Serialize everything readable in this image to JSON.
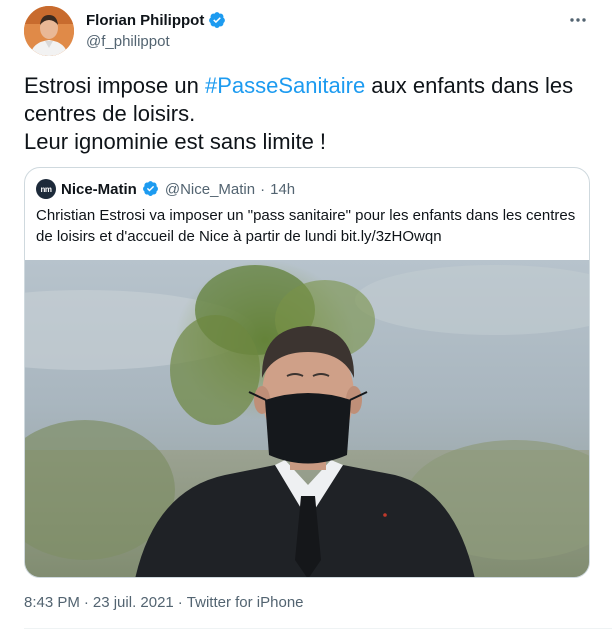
{
  "tweet": {
    "author": {
      "display_name": "Florian Philippot",
      "handle": "@f_philippot",
      "verified": true
    },
    "more_icon": "more-horizontal-icon",
    "text": {
      "line1_before": "Estrosi impose un ",
      "hashtag": "#PasseSanitaire",
      "line1_after": " aux enfants dans les",
      "line2": "centres de loisirs.",
      "line3": "Leur ignominie est sans limite !"
    },
    "quoted": {
      "logo_text": "nm",
      "name": "Nice-Matin",
      "verified": true,
      "handle": "@Nice_Matin",
      "separator": "·",
      "time": "14h",
      "text": "Christian Estrosi va imposer un \"pass sanitaire\" pour les enfants dans les centres de loisirs et d'accueil de Nice à partir de lundi bit.ly/3zHOwqn"
    },
    "meta": {
      "time": "8:43 PM",
      "separator": "·",
      "date": "23 juil. 2021",
      "separator2": "·",
      "source": "Twitter for iPhone"
    }
  },
  "colors": {
    "accent": "#1d9bf0",
    "text": "#0f1419",
    "secondary": "#536471",
    "border": "#cfd9de"
  }
}
